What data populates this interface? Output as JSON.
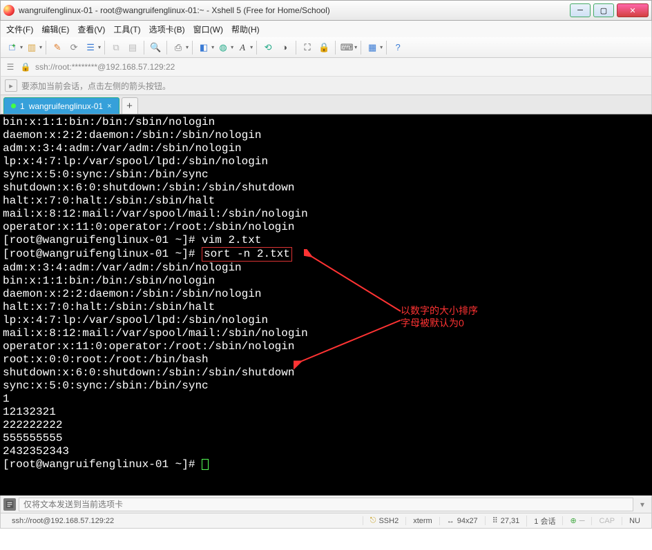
{
  "window": {
    "title": "wangruifenglinux-01 - root@wangruifenglinux-01:~ - Xshell 5 (Free for Home/School)"
  },
  "menu": {
    "file": "文件(F)",
    "edit": "编辑(E)",
    "view": "查看(V)",
    "tools": "工具(T)",
    "tab_opts": "选项卡(B)",
    "window": "窗口(W)",
    "help": "帮助(H)"
  },
  "address": {
    "text": "ssh://root:********@192.168.57.129:22"
  },
  "hint": {
    "text": "要添加当前会话，点击左侧的箭头按钮。"
  },
  "tabs": {
    "t1_index": "1",
    "t1_label": "wangruifenglinux-01",
    "add": "+"
  },
  "terminal": {
    "lines": [
      "bin:x:1:1:bin:/bin:/sbin/nologin",
      "daemon:x:2:2:daemon:/sbin:/sbin/nologin",
      "adm:x:3:4:adm:/var/adm:/sbin/nologin",
      "lp:x:4:7:lp:/var/spool/lpd:/sbin/nologin",
      "sync:x:5:0:sync:/sbin:/bin/sync",
      "shutdown:x:6:0:shutdown:/sbin:/sbin/shutdown",
      "halt:x:7:0:halt:/sbin:/sbin/halt",
      "mail:x:8:12:mail:/var/spool/mail:/sbin/nologin",
      "operator:x:11:0:operator:/root:/sbin/nologin",
      "[root@wangruifenglinux-01 ~]# vim 2.txt",
      "",
      "adm:x:3:4:adm:/var/adm:/sbin/nologin",
      "bin:x:1:1:bin:/bin:/sbin/nologin",
      "daemon:x:2:2:daemon:/sbin:/sbin/nologin",
      "halt:x:7:0:halt:/sbin:/sbin/halt",
      "lp:x:4:7:lp:/var/spool/lpd:/sbin/nologin",
      "mail:x:8:12:mail:/var/spool/mail:/sbin/nologin",
      "operator:x:11:0:operator:/root:/sbin/nologin",
      "root:x:0:0:root:/root:/bin/bash",
      "shutdown:x:6:0:shutdown:/sbin:/sbin/shutdown",
      "sync:x:5:0:sync:/sbin:/bin/sync",
      "1",
      "12132321",
      "222222222",
      "555555555",
      "2432352343",
      "[root@wangruifenglinux-01 ~]# "
    ],
    "prompt_line": "[root@wangruifenglinux-01 ~]# ",
    "boxed_cmd": "sort -n 2.txt",
    "annotation_l1": "以数字的大小排序",
    "annotation_l2": "字母被默认为0"
  },
  "inputbar": {
    "placeholder": "仅将文本发送到当前选项卡"
  },
  "status": {
    "conn": "ssh://root@192.168.57.129:22",
    "ssh": "SSH2",
    "term": "xterm",
    "size": "94x27",
    "pos": "27,31",
    "sess": "1 会话",
    "cap": "CAP",
    "num": "NU"
  }
}
